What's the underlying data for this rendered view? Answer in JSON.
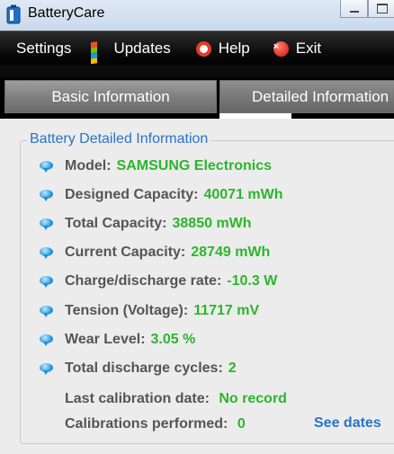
{
  "window": {
    "title": "BatteryCare"
  },
  "menu": {
    "items": [
      {
        "label": "Settings",
        "icon": "none"
      },
      {
        "label": "Updates",
        "icon": "windows-flag-icon"
      },
      {
        "label": "Help",
        "icon": "lifebuoy-icon"
      },
      {
        "label": "Exit",
        "icon": "red-x-icon"
      }
    ]
  },
  "tabs": [
    {
      "label": "Basic Information"
    },
    {
      "label": "Detailed Information"
    }
  ],
  "group": {
    "title": "Battery Detailed Information",
    "rows": [
      {
        "label": "Model:",
        "value": "SAMSUNG Electronics"
      },
      {
        "label": "Designed Capacity:",
        "value": "40071 mWh"
      },
      {
        "label": "Total Capacity:",
        "value": "38850 mWh"
      },
      {
        "label": "Current Capacity:",
        "value": "28749 mWh"
      },
      {
        "label": "Charge/discharge rate:",
        "value": "-10.3 W"
      },
      {
        "label": "Tension (Voltage):",
        "value": "11717 mV"
      },
      {
        "label": "Wear Level:",
        "value": "3.05 %"
      },
      {
        "label": "Total discharge cycles:",
        "value": "2"
      }
    ],
    "calibration": {
      "last_label": "Last calibration date:",
      "last_value": "No record",
      "count_label": "Calibrations performed:",
      "count_value": "0",
      "see_dates": "See dates"
    }
  },
  "colors": {
    "label": "#555555",
    "value": "#2db52d",
    "accent": "#2a73c9"
  }
}
